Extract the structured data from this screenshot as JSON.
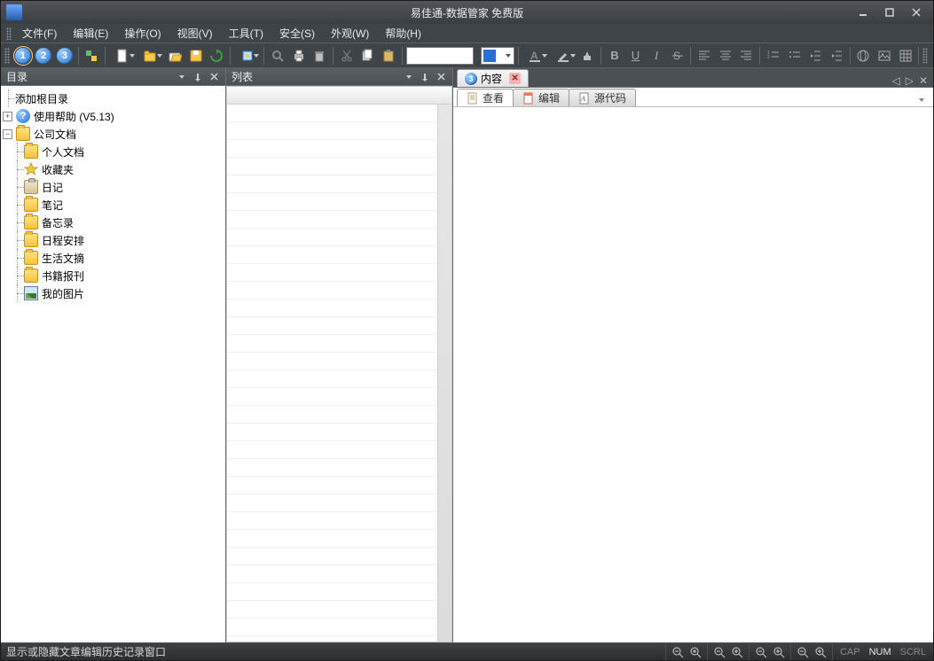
{
  "titlebar": {
    "title": "易佳通-数据管家 免费版"
  },
  "menu": {
    "file": "文件(F)",
    "edit": "编辑(E)",
    "action": "操作(O)",
    "view": "视图(V)",
    "tools": "工具(T)",
    "security": "安全(S)",
    "appearance": "外观(W)",
    "help": "帮助(H)"
  },
  "panes": {
    "directory_title": "目录",
    "list_title": "列表"
  },
  "tree": {
    "add_root": "添加根目录",
    "help_node": "使用帮助 (V5.13)",
    "company_docs": "公司文档",
    "children": {
      "personal": "个人文档",
      "favorites": "收藏夹",
      "diary": "日记",
      "notes": "笔记",
      "memo": "备忘录",
      "schedule": "日程安排",
      "digest": "生活文摘",
      "books": "书籍报刊",
      "pictures": "我的图片"
    }
  },
  "doc_tab": {
    "badge": "3",
    "label": "内容"
  },
  "sub_tabs": {
    "view": "查看",
    "edit": "编辑",
    "source": "源代码"
  },
  "status": {
    "message": "显示或隐藏文章编辑历史记录窗口",
    "cap": "CAP",
    "num": "NUM",
    "scrl": "SCRL"
  },
  "icons": {
    "new_doc": "new-document-icon",
    "refresh": "refresh-icon",
    "cut": "cut-icon",
    "copy": "copy-icon",
    "paste": "paste-icon",
    "bold": "B",
    "underline": "U",
    "italic": "I"
  }
}
